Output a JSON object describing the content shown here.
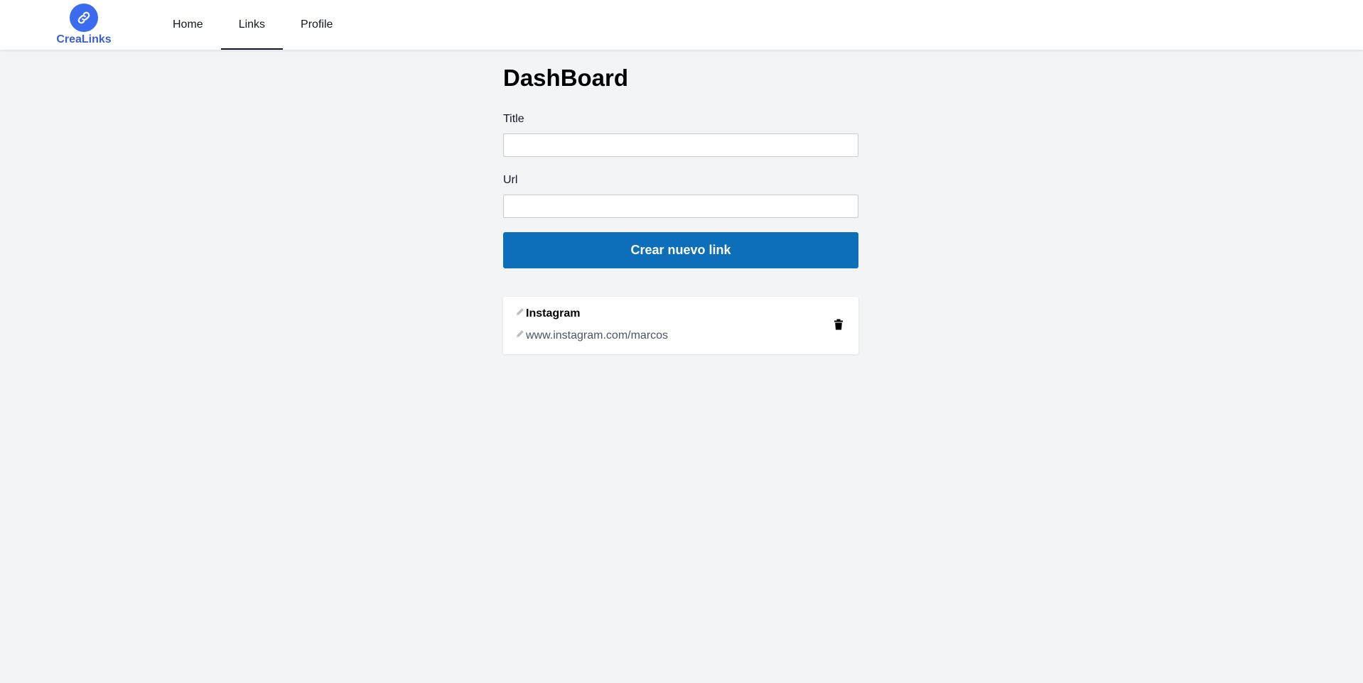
{
  "brand": {
    "name": "CreaLinks",
    "color": "#3b6cf0"
  },
  "nav": {
    "items": [
      {
        "label": "Home"
      },
      {
        "label": "Links",
        "active": true
      },
      {
        "label": "Profile"
      }
    ]
  },
  "page": {
    "title": "DashBoard"
  },
  "form": {
    "title_label": "Title",
    "title_value": "",
    "url_label": "Url",
    "url_value": "",
    "submit_label": "Crear nuevo link",
    "submit_color": "#0d6eb9"
  },
  "links": [
    {
      "title": "Instagram",
      "url": "www.instagram.com/marcos"
    }
  ],
  "icons": {
    "logo": "link-icon",
    "edit": "pencil-icon",
    "delete": "trash-icon"
  }
}
